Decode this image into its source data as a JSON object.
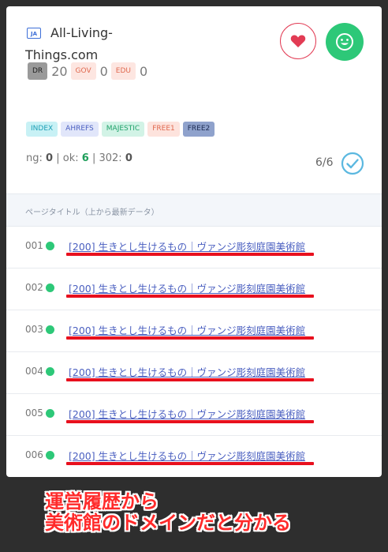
{
  "site": {
    "lang_badge": "JA",
    "name": "All-Living-Things.com"
  },
  "metrics": [
    {
      "label": "DR",
      "value": "20"
    },
    {
      "label": "GOV",
      "value": "0"
    },
    {
      "label": "EDU",
      "value": "0"
    }
  ],
  "actions": {
    "favorite_icon": "heart-icon",
    "smile_icon": "smile-icon",
    "accent_red": "#e23b54",
    "accent_green": "#2dc878"
  },
  "tags": [
    "INDEX",
    "AHREFS",
    "MAJESTIC",
    "FREE1",
    "FREE2"
  ],
  "status": {
    "ng_label": "ng:",
    "ng_value": "0",
    "ok_label": "ok:",
    "ok_value": "6",
    "r302_label": "302:",
    "r302_value": "0",
    "ratio": "6/6"
  },
  "list": {
    "header": "ページタイトル（上から最新データ）",
    "rows": [
      {
        "num": "001",
        "title": "[200] 生きとし生けるもの｜ヴァンジ彫刻庭園美術館"
      },
      {
        "num": "002",
        "title": "[200] 生きとし生けるもの｜ヴァンジ彫刻庭園美術館"
      },
      {
        "num": "003",
        "title": "[200] 生きとし生けるもの｜ヴァンジ彫刻庭園美術館"
      },
      {
        "num": "004",
        "title": "[200] 生きとし生けるもの｜ヴァンジ彫刻庭園美術館"
      },
      {
        "num": "005",
        "title": "[200] 生きとし生けるもの｜ヴァンジ彫刻庭園美術館"
      },
      {
        "num": "006",
        "title": "[200] 生きとし生けるもの｜ヴァンジ彫刻庭園美術館"
      }
    ]
  },
  "annotation": {
    "line1": "運営履歴から",
    "line2": "美術館のドメインだと分かる"
  }
}
